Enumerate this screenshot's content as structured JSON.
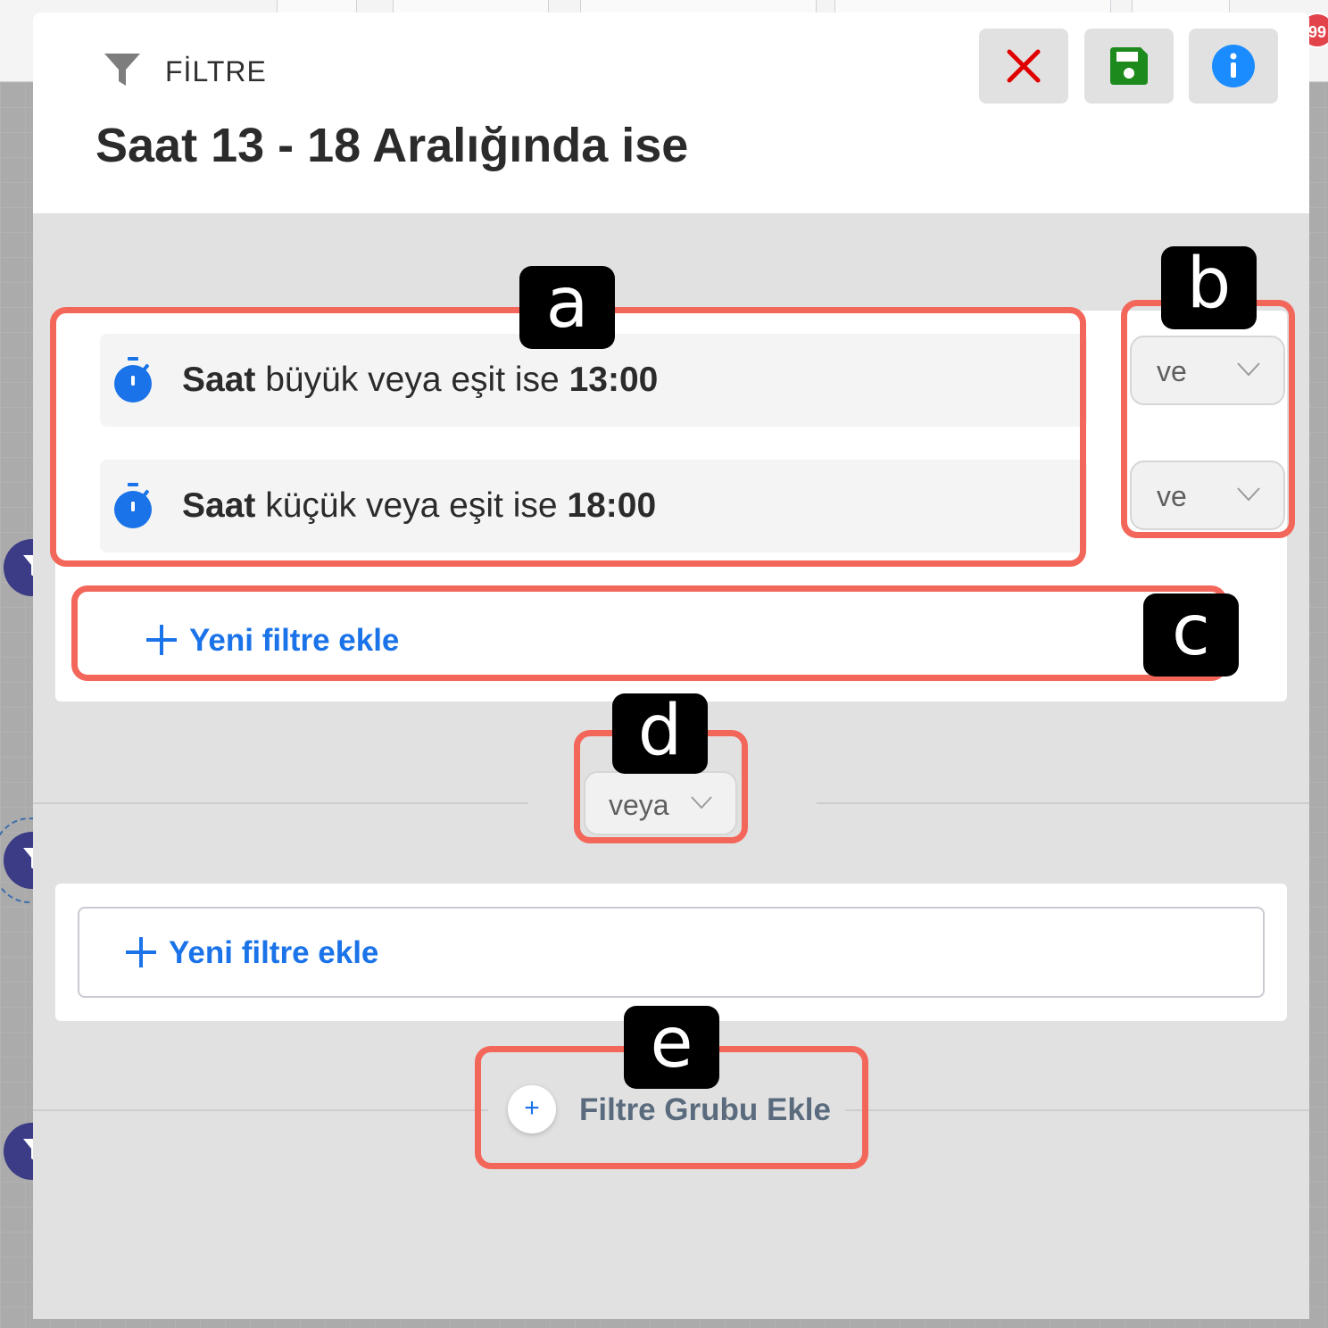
{
  "background": {
    "notification_count": "99"
  },
  "header": {
    "section_label": "FİLTRE",
    "title": "Saat 13 - 18 Aralığında ise",
    "icons": [
      "filter-icon",
      "close-icon",
      "save-icon",
      "info-icon"
    ],
    "colors": {
      "close": "#e00000",
      "save": "#1d8a1d",
      "info": "#1a8cff"
    }
  },
  "group1": {
    "rules": [
      {
        "field": "Saat",
        "operator": "büyük veya eşit ise",
        "value": "13:00",
        "icon": "timer-icon"
      },
      {
        "field": "Saat",
        "operator": "küçük veya eşit ise",
        "value": "18:00",
        "icon": "timer-icon"
      }
    ],
    "connectors": [
      "ve",
      "ve"
    ],
    "add_filter_label": "Yeni filtre ekle"
  },
  "group_connector": "veya",
  "group2": {
    "add_filter_label": "Yeni filtre ekle"
  },
  "add_group": {
    "plus": "+",
    "label": "Filtre Grubu Ekle"
  },
  "annotations": [
    "a",
    "b",
    "c",
    "d",
    "e"
  ],
  "colors": {
    "accent": "#1a73e8",
    "highlight": "#f3665a",
    "timer": "#1a73e8"
  }
}
